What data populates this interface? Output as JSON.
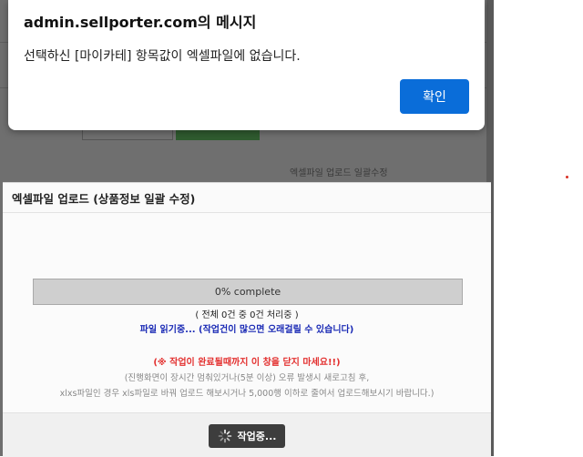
{
  "alert": {
    "title": "admin.sellporter.com의 메시지",
    "message": "선택하신 [마이카테] 항목값이 엑셀파일에 없습니다.",
    "ok_label": "확인"
  },
  "background": {
    "caption": "엑셀파일 업로드 일괄수정"
  },
  "upload_modal": {
    "title": "엑셀파일 업로드 (상품정보 일괄 수정)",
    "progress_text": "0% complete",
    "progress_percent": 0,
    "count_line": "( 전체 0건 중 0건 처리중 )",
    "reading_line": "파일 읽기중... (작업건이 많으면 오래걸릴 수 있습니다)",
    "warning_line": "(※ 작업이 완료될때까지 이 창을 닫지 마세요!!)",
    "note_line1": "(진행화면이 장시간 멈춰있거나(5분 이상) 오류 발생시 새로고침 후,",
    "note_line2": "xlxs파일인 경우 xls파일로 바꿔 업로드 해보시거나 5,000행 이하로 줄여서 업로드해보시기 바랍니다.)",
    "working_label": "작업중...",
    "working_icon": "spinner-icon"
  },
  "colors": {
    "ok_button": "#0a6dd9",
    "warning": "#e3302f",
    "info": "#1a2ab5",
    "overlay": "#6f6f6f"
  }
}
